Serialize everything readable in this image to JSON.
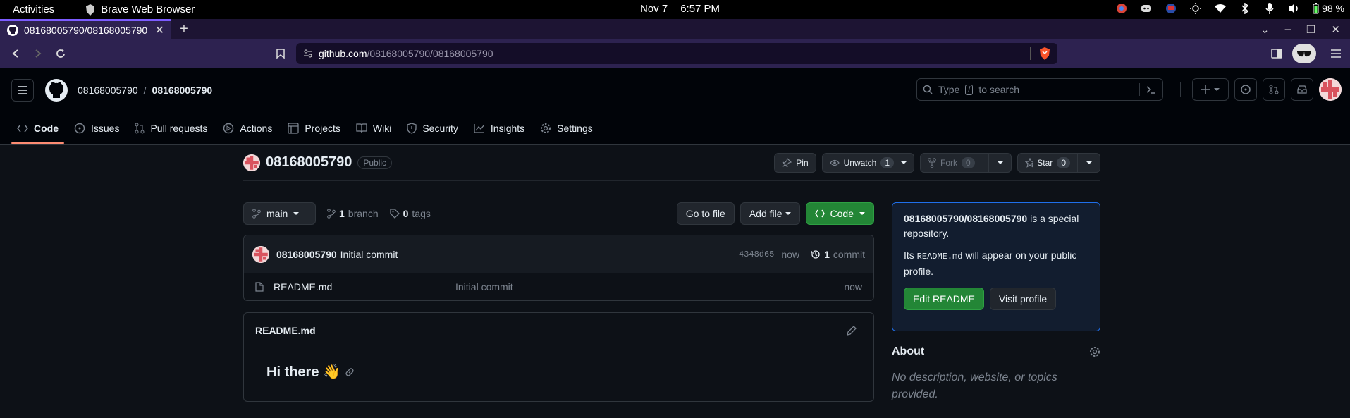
{
  "system": {
    "activities": "Activities",
    "app_name": "Brave Web Browser",
    "date": "Nov 7",
    "time": "6:57 PM",
    "battery": "98 %"
  },
  "browser": {
    "tab_title": "08168005790/08168005790",
    "url_host": "github.com",
    "url_path": "/08168005790/08168005790"
  },
  "github": {
    "owner": "08168005790",
    "repo": "08168005790",
    "search_prefix": "Type",
    "search_key": "/",
    "search_suffix": "to search",
    "nav": [
      {
        "label": "Code",
        "icon": "code-icon"
      },
      {
        "label": "Issues",
        "icon": "issue-icon"
      },
      {
        "label": "Pull requests",
        "icon": "pull-request-icon"
      },
      {
        "label": "Actions",
        "icon": "play-icon"
      },
      {
        "label": "Projects",
        "icon": "table-icon"
      },
      {
        "label": "Wiki",
        "icon": "book-icon"
      },
      {
        "label": "Security",
        "icon": "shield-icon"
      },
      {
        "label": "Insights",
        "icon": "graph-icon"
      },
      {
        "label": "Settings",
        "icon": "gear-icon"
      }
    ]
  },
  "repo": {
    "name": "08168005790",
    "visibility": "Public",
    "pin": "Pin",
    "unwatch": "Unwatch",
    "unwatch_count": "1",
    "fork": "Fork",
    "fork_count": "0",
    "star": "Star",
    "star_count": "0",
    "branch_name": "main",
    "branch_count": "1",
    "branch_label": "branch",
    "tag_count": "0",
    "tag_label": "tags",
    "go_to_file": "Go to file",
    "add_file": "Add file",
    "code_button": "Code",
    "commit_author": "08168005790",
    "commit_message": "Initial commit",
    "commit_hash": "4348d65",
    "commit_time": "now",
    "commit_count": "1",
    "commit_label": "commit",
    "files": [
      {
        "name": "README.md",
        "message": "Initial commit",
        "time": "now"
      }
    ],
    "readme_title": "README.md",
    "readme_heading": "Hi there 👋"
  },
  "sidebar": {
    "special_repo": "08168005790/08168005790",
    "special_text1": "is a special repository.",
    "special_its": "Its",
    "special_code": "README.md",
    "special_text2": "will appear on your public profile.",
    "edit_readme": "Edit README",
    "visit_profile": "Visit profile",
    "about_title": "About",
    "about_desc": "No description, website, or topics provided."
  },
  "colors": {
    "accent_tab": "#fd8c73",
    "green_button": "#238636",
    "link_blue": "#1f6feb"
  }
}
